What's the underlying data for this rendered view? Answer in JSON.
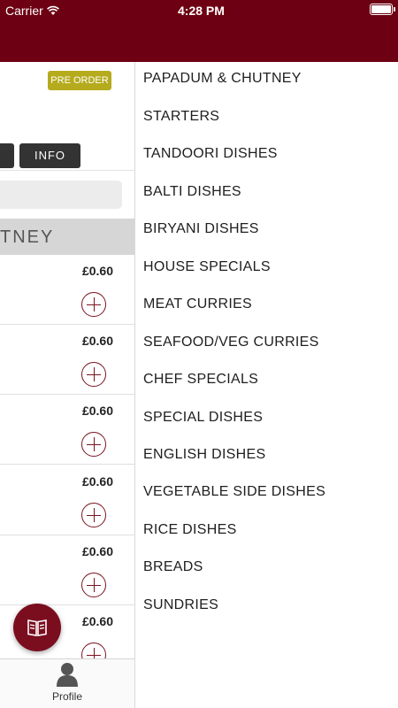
{
  "status_bar": {
    "carrier": "Carrier",
    "time": "4:28 PM"
  },
  "header": {
    "preorder_label": "PRE ORDER",
    "info_label": "INFO"
  },
  "category": {
    "title": "TNEY"
  },
  "items": [
    {
      "price": "£0.60"
    },
    {
      "price": "£0.60"
    },
    {
      "price": "£0.60"
    },
    {
      "price": "£0.60"
    },
    {
      "price": "£0.60"
    },
    {
      "price": "£0.60"
    }
  ],
  "bottom_nav": {
    "profile_label": "Profile"
  },
  "menu": [
    "PAPADUM & CHUTNEY",
    "STARTERS",
    "TANDOORI DISHES",
    "BALTI DISHES",
    "BIRYANI DISHES",
    "HOUSE SPECIALS",
    "MEAT CURRIES",
    "SEAFOOD/VEG CURRIES",
    "CHEF SPECIALS",
    "SPECIAL DISHES",
    "ENGLISH DISHES",
    "VEGETABLE SIDE DISHES",
    "RICE DISHES",
    "BREADS",
    "SUNDRIES"
  ],
  "colors": {
    "brand": "#6d0012",
    "accent": "#b5ab1d",
    "icon_accent": "#7a1320"
  }
}
